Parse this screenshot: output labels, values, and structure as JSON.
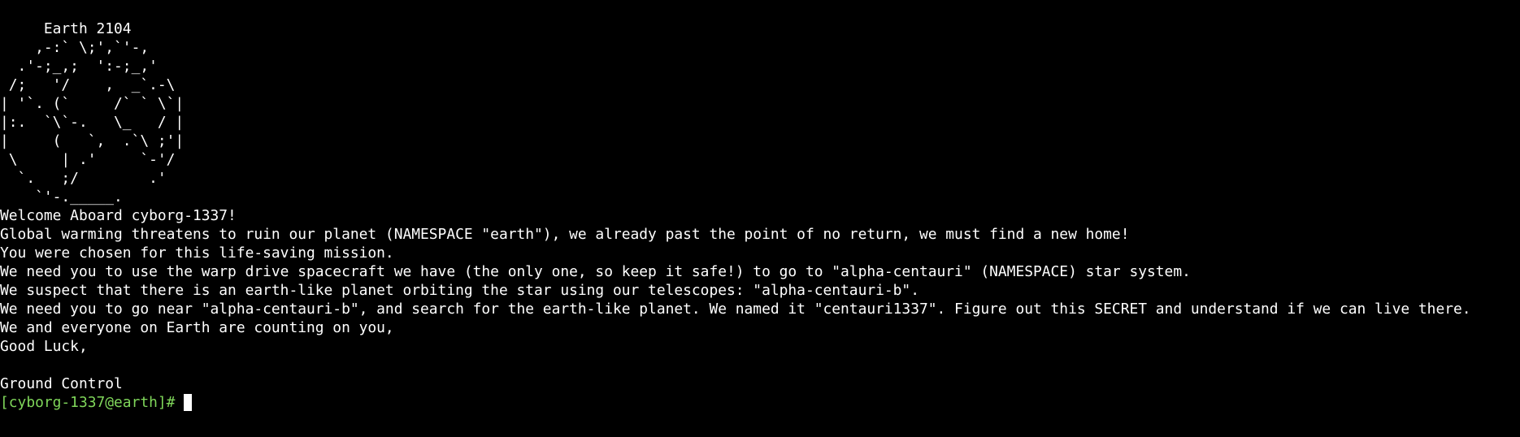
{
  "terminal": {
    "ascii_art": [
      "     Earth 2104",
      "    ,-:` \\;',`'-,",
      "  .'-;_,;  ':-;_,'",
      " /;   '/    ,  _`.-\\",
      "| '`. (`     /` ` \\`|",
      "|:.  `\\`-.   \\_   / |",
      "|     (   `,  .`\\ ;'|",
      " \\     | .'     `-'/",
      "  `.   ;/        .'",
      "    `'-._____."
    ],
    "message_lines": [
      "Welcome Aboard cyborg-1337!",
      "Global warming threatens to ruin our planet (NAMESPACE \"earth\"), we already past the point of no return, we must find a new home!",
      "You were chosen for this life-saving mission.",
      "We need you to use the warp drive spacecraft we have (the only one, so keep it safe!) to go to \"alpha-centauri\" (NAMESPACE) star system.",
      "We suspect that there is an earth-like planet orbiting the star using our telescopes: \"alpha-centauri-b\".",
      "We need you to go near \"alpha-centauri-b\", and search for the earth-like planet. We named it \"centauri1337\". Figure out this SECRET and understand if we can live there.",
      "We and everyone on Earth are counting on you,",
      "Good Luck,",
      "",
      "Ground Control"
    ],
    "prompt": "[cyborg-1337@earth]#",
    "colors": {
      "background": "#000000",
      "text": "#ffffff",
      "prompt": "#7fd65a"
    }
  }
}
